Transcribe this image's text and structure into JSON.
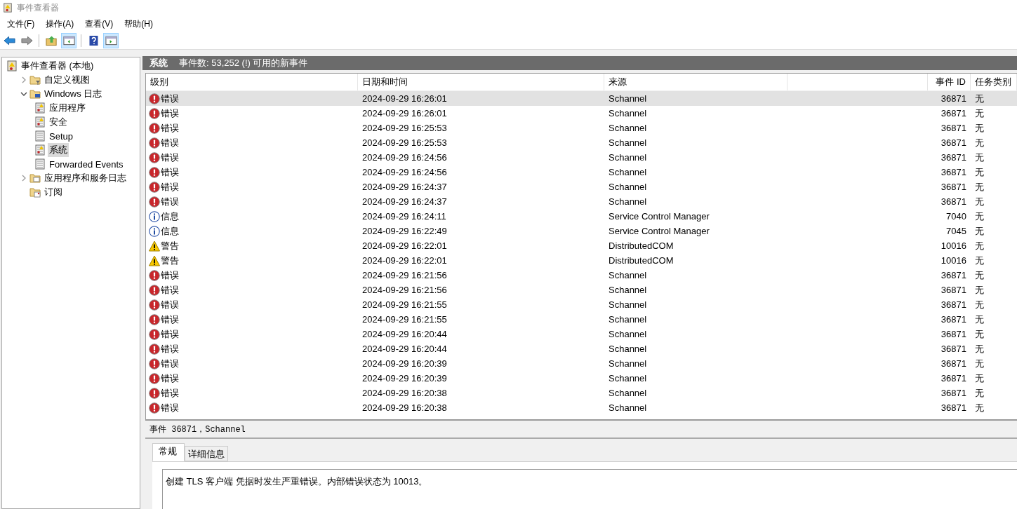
{
  "window": {
    "title": "事件查看器"
  },
  "menu": [
    "文件(F)",
    "操作(A)",
    "查看(V)",
    "帮助(H)"
  ],
  "toolbar": [
    {
      "kind": "back",
      "pressed": false
    },
    {
      "kind": "forward",
      "pressed": false
    },
    {
      "kind": "up",
      "pressed": false
    },
    {
      "kind": "tree",
      "pressed": true
    },
    {
      "kind": "help",
      "pressed": false
    },
    {
      "kind": "actions",
      "pressed": true
    }
  ],
  "tree": [
    {
      "label": "事件查看器 (本地)",
      "kind": "viewer",
      "selected": false,
      "children": [
        {
          "label": "自定义视图",
          "kind": "filter",
          "expanded": false,
          "selected": false
        },
        {
          "label": "Windows 日志",
          "kind": "logs",
          "expanded": true,
          "selected": false,
          "children": [
            {
              "label": "应用程序",
              "kind": "alert",
              "selected": false
            },
            {
              "label": "安全",
              "kind": "alert",
              "selected": false
            },
            {
              "label": "Setup",
              "kind": "plain",
              "selected": false
            },
            {
              "label": "系统",
              "kind": "alert",
              "selected": true
            },
            {
              "label": "Forwarded Events",
              "kind": "plain",
              "selected": false
            }
          ]
        },
        {
          "label": "应用程序和服务日志",
          "kind": "folder",
          "expanded": false,
          "selected": false
        },
        {
          "label": "订阅",
          "kind": "subscription",
          "selected": false
        }
      ]
    }
  ],
  "header": {
    "title": "系统",
    "summary": "事件数: 53,252 (!) 可用的新事件"
  },
  "table": {
    "columns": [
      "级别",
      "日期和时间",
      "来源",
      "事件 ID",
      "任务类别"
    ],
    "rows": [
      {
        "kind": "error",
        "level": "错误",
        "date": "2024-09-29 16:26:01",
        "source": "Schannel",
        "id": "36871",
        "category": "无",
        "selected": true
      },
      {
        "kind": "error",
        "level": "错误",
        "date": "2024-09-29 16:26:01",
        "source": "Schannel",
        "id": "36871",
        "category": "无",
        "selected": false
      },
      {
        "kind": "error",
        "level": "错误",
        "date": "2024-09-29 16:25:53",
        "source": "Schannel",
        "id": "36871",
        "category": "无",
        "selected": false
      },
      {
        "kind": "error",
        "level": "错误",
        "date": "2024-09-29 16:25:53",
        "source": "Schannel",
        "id": "36871",
        "category": "无",
        "selected": false
      },
      {
        "kind": "error",
        "level": "错误",
        "date": "2024-09-29 16:24:56",
        "source": "Schannel",
        "id": "36871",
        "category": "无",
        "selected": false
      },
      {
        "kind": "error",
        "level": "错误",
        "date": "2024-09-29 16:24:56",
        "source": "Schannel",
        "id": "36871",
        "category": "无",
        "selected": false
      },
      {
        "kind": "error",
        "level": "错误",
        "date": "2024-09-29 16:24:37",
        "source": "Schannel",
        "id": "36871",
        "category": "无",
        "selected": false
      },
      {
        "kind": "error",
        "level": "错误",
        "date": "2024-09-29 16:24:37",
        "source": "Schannel",
        "id": "36871",
        "category": "无",
        "selected": false
      },
      {
        "kind": "info",
        "level": "信息",
        "date": "2024-09-29 16:24:11",
        "source": "Service Control Manager",
        "id": "7040",
        "category": "无",
        "selected": false
      },
      {
        "kind": "info",
        "level": "信息",
        "date": "2024-09-29 16:22:49",
        "source": "Service Control Manager",
        "id": "7045",
        "category": "无",
        "selected": false
      },
      {
        "kind": "warning",
        "level": "警告",
        "date": "2024-09-29 16:22:01",
        "source": "DistributedCOM",
        "id": "10016",
        "category": "无",
        "selected": false
      },
      {
        "kind": "warning",
        "level": "警告",
        "date": "2024-09-29 16:22:01",
        "source": "DistributedCOM",
        "id": "10016",
        "category": "无",
        "selected": false
      },
      {
        "kind": "error",
        "level": "错误",
        "date": "2024-09-29 16:21:56",
        "source": "Schannel",
        "id": "36871",
        "category": "无",
        "selected": false
      },
      {
        "kind": "error",
        "level": "错误",
        "date": "2024-09-29 16:21:56",
        "source": "Schannel",
        "id": "36871",
        "category": "无",
        "selected": false
      },
      {
        "kind": "error",
        "level": "错误",
        "date": "2024-09-29 16:21:55",
        "source": "Schannel",
        "id": "36871",
        "category": "无",
        "selected": false
      },
      {
        "kind": "error",
        "level": "错误",
        "date": "2024-09-29 16:21:55",
        "source": "Schannel",
        "id": "36871",
        "category": "无",
        "selected": false
      },
      {
        "kind": "error",
        "level": "错误",
        "date": "2024-09-29 16:20:44",
        "source": "Schannel",
        "id": "36871",
        "category": "无",
        "selected": false
      },
      {
        "kind": "error",
        "level": "错误",
        "date": "2024-09-29 16:20:44",
        "source": "Schannel",
        "id": "36871",
        "category": "无",
        "selected": false
      },
      {
        "kind": "error",
        "level": "错误",
        "date": "2024-09-29 16:20:39",
        "source": "Schannel",
        "id": "36871",
        "category": "无",
        "selected": false
      },
      {
        "kind": "error",
        "level": "错误",
        "date": "2024-09-29 16:20:39",
        "source": "Schannel",
        "id": "36871",
        "category": "无",
        "selected": false
      },
      {
        "kind": "error",
        "level": "错误",
        "date": "2024-09-29 16:20:38",
        "source": "Schannel",
        "id": "36871",
        "category": "无",
        "selected": false
      },
      {
        "kind": "error",
        "level": "错误",
        "date": "2024-09-29 16:20:38",
        "source": "Schannel",
        "id": "36871",
        "category": "无",
        "selected": false
      }
    ]
  },
  "detail": {
    "title": "事件 36871，Schannel",
    "tabs": [
      {
        "label": "常规",
        "selected": true
      },
      {
        "label": "详细信息",
        "selected": false
      }
    ],
    "message": "创建 TLS 客户端 凭据时发生严重错误。内部错误状态为 10013。"
  }
}
